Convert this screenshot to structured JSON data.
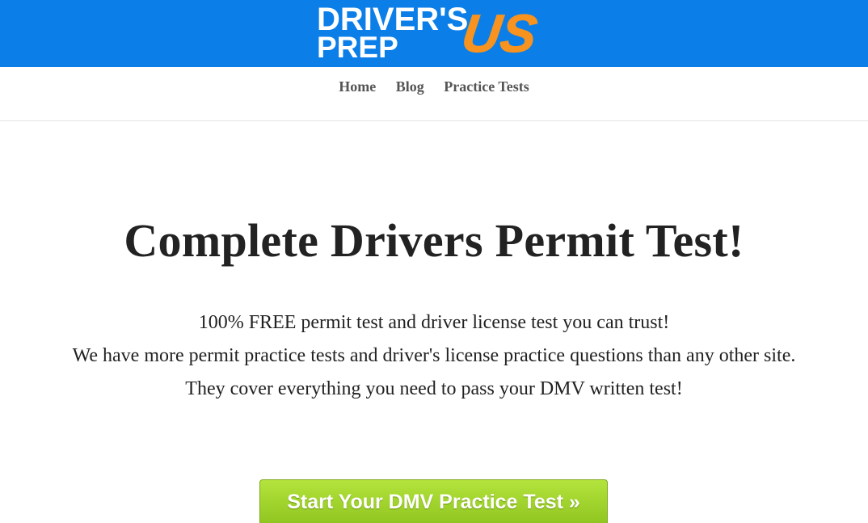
{
  "header": {
    "logo": {
      "line1": "DRIVER'S",
      "line2": "PREP",
      "accent": "US"
    },
    "background_color": "#0b7ee8",
    "accent_color": "#f7931e"
  },
  "nav": {
    "items": [
      {
        "label": "Home"
      },
      {
        "label": "Blog"
      },
      {
        "label": "Practice Tests"
      }
    ]
  },
  "hero": {
    "title": "Complete Drivers Permit Test!",
    "lines": [
      "100% FREE permit test and driver license test you can trust!",
      "We have more permit practice tests and driver's license practice questions than any other site.",
      "They cover everything you need to pass your DMV written test!"
    ]
  },
  "cta": {
    "label": "Start Your DMV Practice Test »",
    "color": "#9ed12b"
  }
}
